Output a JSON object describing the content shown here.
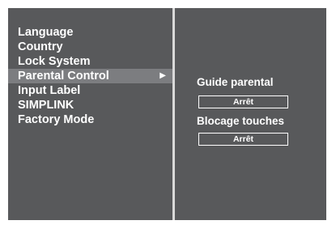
{
  "menu": {
    "items": [
      {
        "label": "Language"
      },
      {
        "label": "Country"
      },
      {
        "label": "Lock System"
      },
      {
        "label": "Parental Control",
        "arrow": "▶"
      },
      {
        "label": "Input Label"
      },
      {
        "label": "SIMPLINK"
      },
      {
        "label": "Factory Mode"
      }
    ],
    "selected_index": 3
  },
  "submenu": {
    "guide": {
      "label": "Guide parental",
      "value": "Arrêt"
    },
    "lock": {
      "label": "Blocage touches",
      "value": "Arrêt"
    }
  },
  "colors": {
    "panel_background": "#58595b",
    "highlight": "#7c7d80",
    "divider": "#d9d9d9",
    "text": "#ffffff"
  }
}
